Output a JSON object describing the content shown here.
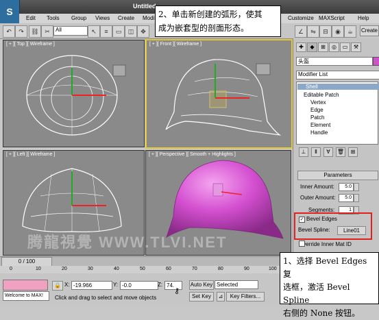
{
  "window": {
    "title": "Untitled",
    "logo_text": "S"
  },
  "menu": [
    "Edit",
    "Tools",
    "Group",
    "Views",
    "Create",
    "Modi",
    "Customize",
    "MAXScript",
    "Help"
  ],
  "toolbar": {
    "selection_filter": "All",
    "create_label": "Create"
  },
  "viewports": {
    "top": {
      "label": "[ + ][ Top ][ Wireframe ]"
    },
    "front": {
      "label": "[ + ][ Front ][ Wireframe ]"
    },
    "left": {
      "label": "[ + ][ Left ][ Wireframe ]"
    },
    "perspective": {
      "label": "[ + ][ Perspective ][ Smooth + Highlights ]"
    }
  },
  "command_panel": {
    "object_name": "头盔",
    "modifier_list": "Modifier List",
    "stack": [
      "Shell",
      "Editable Patch",
      "Vertex",
      "Edge",
      "Patch",
      "Element",
      "Handle"
    ],
    "parameters_title": "Parameters",
    "inner_amount_label": "Inner Amount:",
    "inner_amount_value": "5.0",
    "outer_amount_label": "Outer Amount:",
    "outer_amount_value": "5.0",
    "segments_label": "Segments:",
    "segments_value": "1",
    "bevel_edges_label": "Bevel Edges",
    "bevel_spline_label": "Bevel Spline:",
    "bevel_spline_value": "Line01",
    "override_label": "Override Inner Mat ID"
  },
  "timeline": {
    "slider": "0 / 100",
    "ticks": [
      "0",
      "10",
      "20",
      "30",
      "40",
      "50",
      "60",
      "70",
      "80",
      "90",
      "100"
    ]
  },
  "statusbar": {
    "welcome": "Welcome to MAX!",
    "x_label": "X:",
    "x_value": "-19.966",
    "y_label": "Y:",
    "y_value": "-0.0",
    "z_label": "Z:",
    "z_value": "74.",
    "prompt": "Click and drag to select and move objects",
    "auto_key": "Auto Key",
    "set_key": "Set Key",
    "selected": "Selected",
    "key_filters": "Key Filters..."
  },
  "annotations": {
    "callout_top_line1": "2、单击新创建的弧形，使其",
    "callout_top_line2": "成为嵌套型的剖面形态。",
    "callout_bottom_line1": "1、选择 Bevel Edges 复",
    "callout_bottom_line2": "选框，激活 Bevel Spline",
    "callout_bottom_line3": "右侧的 None 按钮。",
    "watermark": "腾龍視覺 WWW.TLVI.NET"
  },
  "colors": {
    "helmet": "#d44fd0",
    "viewport_bg": "#8a8a8a",
    "active_border": "#e2c838",
    "highlight": "#e02020"
  }
}
